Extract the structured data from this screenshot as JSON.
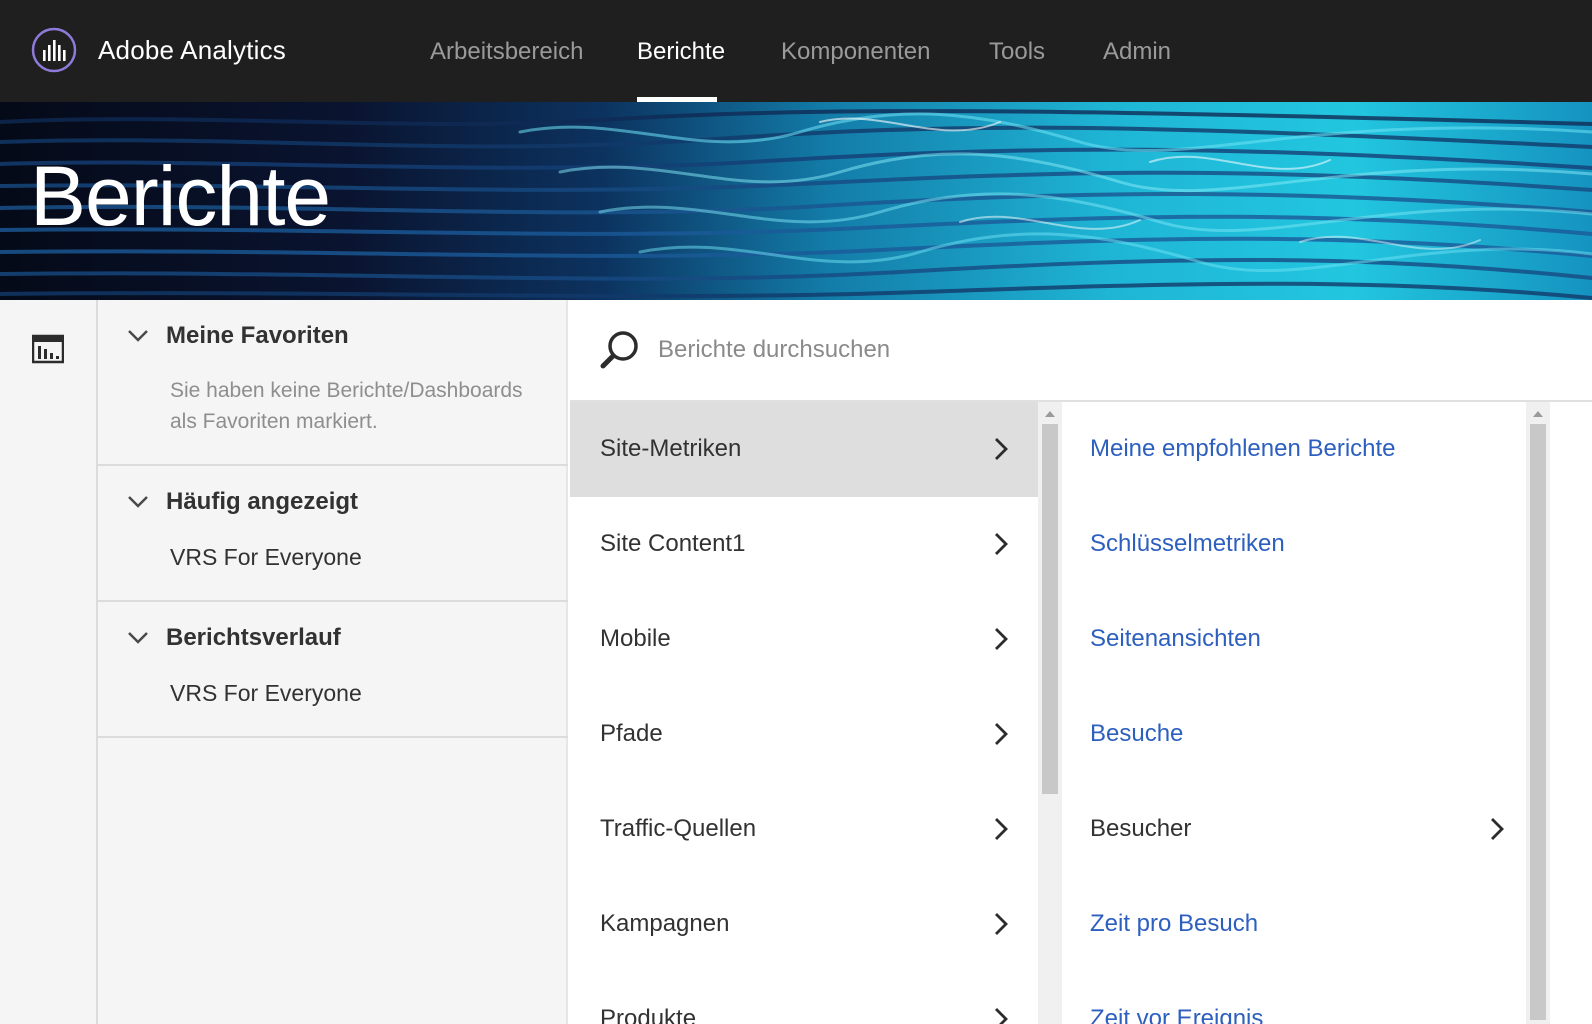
{
  "app": {
    "title": "Adobe Analytics"
  },
  "nav": {
    "items": [
      {
        "label": "Arbeitsbereich"
      },
      {
        "label": "Berichte"
      },
      {
        "label": "Komponenten"
      },
      {
        "label": "Tools"
      },
      {
        "label": "Admin"
      }
    ],
    "active": "Berichte"
  },
  "banner": {
    "title": "Berichte"
  },
  "sidebar": {
    "sections": [
      {
        "title": "Meine Favoriten",
        "empty_text": "Sie haben keine Berichte/Dashboards als Favoriten markiert."
      },
      {
        "title": "Häufig angezeigt",
        "items": [
          "VRS For Everyone"
        ]
      },
      {
        "title": "Berichtsverlauf",
        "items": [
          "VRS For Everyone"
        ]
      }
    ]
  },
  "search": {
    "placeholder": "Berichte durchsuchen",
    "value": ""
  },
  "categories": {
    "selected": "Site-Metriken",
    "items": [
      {
        "label": "Site-Metriken"
      },
      {
        "label": "Site Content1"
      },
      {
        "label": "Mobile"
      },
      {
        "label": "Pfade"
      },
      {
        "label": "Traffic-Quellen"
      },
      {
        "label": "Kampagnen"
      },
      {
        "label": "Produkte"
      }
    ]
  },
  "reports": {
    "items": [
      {
        "label": "Meine empfohlenen Berichte",
        "link": true
      },
      {
        "label": "Schlüsselmetriken",
        "link": true
      },
      {
        "label": "Seitenansichten",
        "link": true
      },
      {
        "label": "Besuche",
        "link": true
      },
      {
        "label": "Besucher",
        "link": false,
        "has_submenu": true
      },
      {
        "label": "Zeit pro Besuch",
        "link": true
      },
      {
        "label": "Zeit vor Ereignis",
        "link": true
      }
    ]
  },
  "colors": {
    "topbar": "#1f1f1f",
    "link": "#2d5fbf",
    "selected_row": "#dedede",
    "panel_bg": "#f5f5f5"
  }
}
